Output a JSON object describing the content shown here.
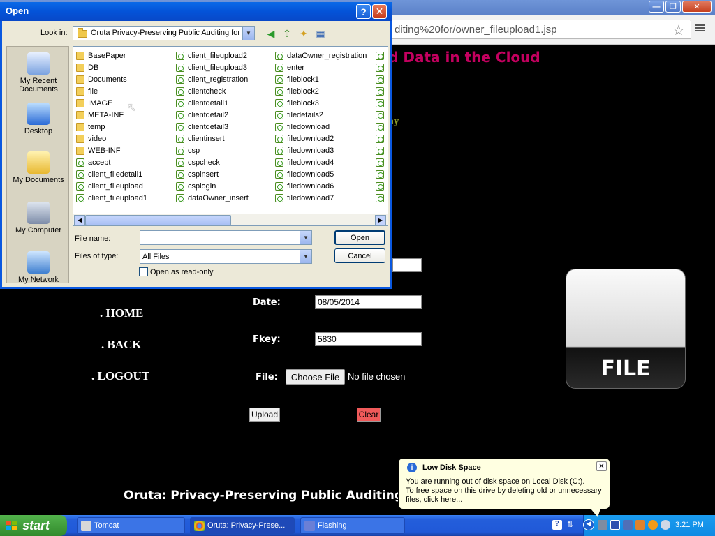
{
  "browser": {
    "url_fragment": "diting%20for/owner_fileupload1.jsp",
    "window_controls": [
      "—",
      "❐",
      "✕"
    ]
  },
  "page": {
    "header_fragment": "g for Shared Data in the Cloud",
    "green_fragment": "day",
    "nav": [
      "HOME",
      "BACK",
      "LOGOUT"
    ],
    "date_label": "Date:",
    "date_value": "08/05/2014",
    "fkey_label": "Fkey:",
    "fkey_value": "5830",
    "file_label": "File:",
    "choose_file": "Choose File",
    "no_file": "No file chosen",
    "upload": "Upload",
    "clear": "Clear",
    "file_icon_text": "FILE",
    "footer": "Oruta: Privacy-Preserving Public Auditing"
  },
  "dialog": {
    "title": "Open",
    "help": "?",
    "close": "✕",
    "look_in_label": "Look in:",
    "look_in_value": "Oruta Privacy-Preserving Public Auditing for",
    "places": [
      "My Recent Documents",
      "Desktop",
      "My Documents",
      "My Computer",
      "My Network"
    ],
    "col1": [
      {
        "name": "BasePaper",
        "type": "folder"
      },
      {
        "name": "DB",
        "type": "folder"
      },
      {
        "name": "Documents",
        "type": "folder"
      },
      {
        "name": "file",
        "type": "folder"
      },
      {
        "name": "IMAGE",
        "type": "folder"
      },
      {
        "name": "META-INF",
        "type": "folder"
      },
      {
        "name": "temp",
        "type": "folder"
      },
      {
        "name": "video",
        "type": "folder"
      },
      {
        "name": "WEB-INF",
        "type": "folder"
      },
      {
        "name": "accept",
        "type": "jsp"
      },
      {
        "name": "client_filedetail1",
        "type": "jsp"
      },
      {
        "name": "client_fileupload",
        "type": "jsp"
      },
      {
        "name": "client_fileupload1",
        "type": "jsp"
      }
    ],
    "col2": [
      {
        "name": "client_fileupload2",
        "type": "jsp"
      },
      {
        "name": "client_fileupload3",
        "type": "jsp"
      },
      {
        "name": "client_registration",
        "type": "jsp"
      },
      {
        "name": "clientcheck",
        "type": "jsp"
      },
      {
        "name": "clientdetail1",
        "type": "jsp"
      },
      {
        "name": "clientdetail2",
        "type": "jsp"
      },
      {
        "name": "clientdetail3",
        "type": "jsp"
      },
      {
        "name": "clientinsert",
        "type": "jsp"
      },
      {
        "name": "csp",
        "type": "jsp"
      },
      {
        "name": "cspcheck",
        "type": "jsp"
      },
      {
        "name": "cspinsert",
        "type": "jsp"
      },
      {
        "name": "csplogin",
        "type": "jsp"
      },
      {
        "name": "dataOwner_insert",
        "type": "jsp"
      }
    ],
    "col3": [
      {
        "name": "dataOwner_registration",
        "type": "jsp"
      },
      {
        "name": "enter",
        "type": "jsp"
      },
      {
        "name": "fileblock1",
        "type": "jsp"
      },
      {
        "name": "fileblock2",
        "type": "jsp"
      },
      {
        "name": "fileblock3",
        "type": "jsp"
      },
      {
        "name": "filedetails2",
        "type": "jsp"
      },
      {
        "name": "filedownload",
        "type": "jsp"
      },
      {
        "name": "filedownload2",
        "type": "jsp"
      },
      {
        "name": "filedownload3",
        "type": "jsp"
      },
      {
        "name": "filedownload4",
        "type": "jsp"
      },
      {
        "name": "filedownload5",
        "type": "jsp"
      },
      {
        "name": "filedownload6",
        "type": "jsp"
      },
      {
        "name": "filedownload7",
        "type": "jsp"
      }
    ],
    "file_name_label": "File name:",
    "file_name_value": "",
    "files_of_type_label": "Files of type:",
    "files_of_type_value": "All Files",
    "open_button": "Open",
    "cancel_button": "Cancel",
    "readonly_label": "Open as read-only"
  },
  "taskbar": {
    "start": "start",
    "tasks": [
      "Tomcat",
      "Oruta: Privacy-Prese...",
      "Flashing"
    ],
    "clock": "3:21 PM"
  },
  "balloon": {
    "title": "Low Disk Space",
    "line1": "You are running out of disk space on Local Disk (C:).",
    "line2": "To free space on this drive by deleting old or unnecessary",
    "line3": "files, click here..."
  }
}
